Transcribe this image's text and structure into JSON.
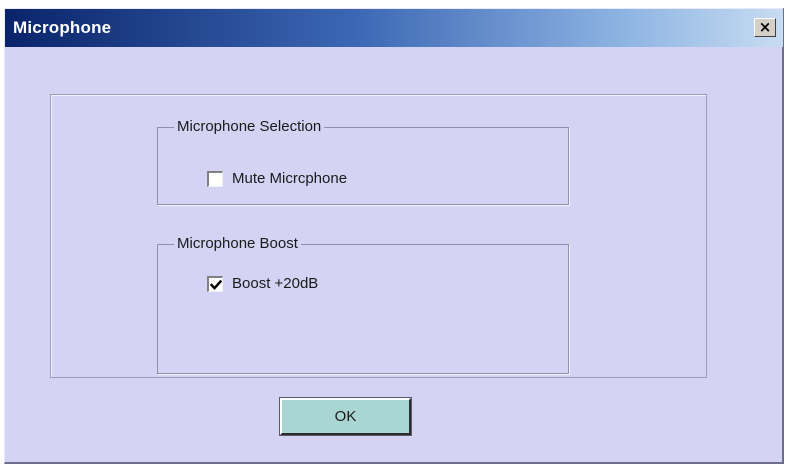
{
  "window": {
    "title": "Microphone",
    "close_label": "×"
  },
  "microphone_selection": {
    "legend": "Microphone Selection",
    "mute_label": "Mute Micrcphone",
    "mute_checked": false
  },
  "microphone_boost": {
    "legend": "Microphone Boost",
    "boost_label": "Boost +20dB",
    "boost_checked": true
  },
  "buttons": {
    "ok_label": "OK"
  },
  "colors": {
    "dialog_background": "#d4d3f3",
    "titlebar_start": "#0a246a",
    "titlebar_end": "#c7dcf1",
    "ok_button": "#a9d6d3"
  }
}
